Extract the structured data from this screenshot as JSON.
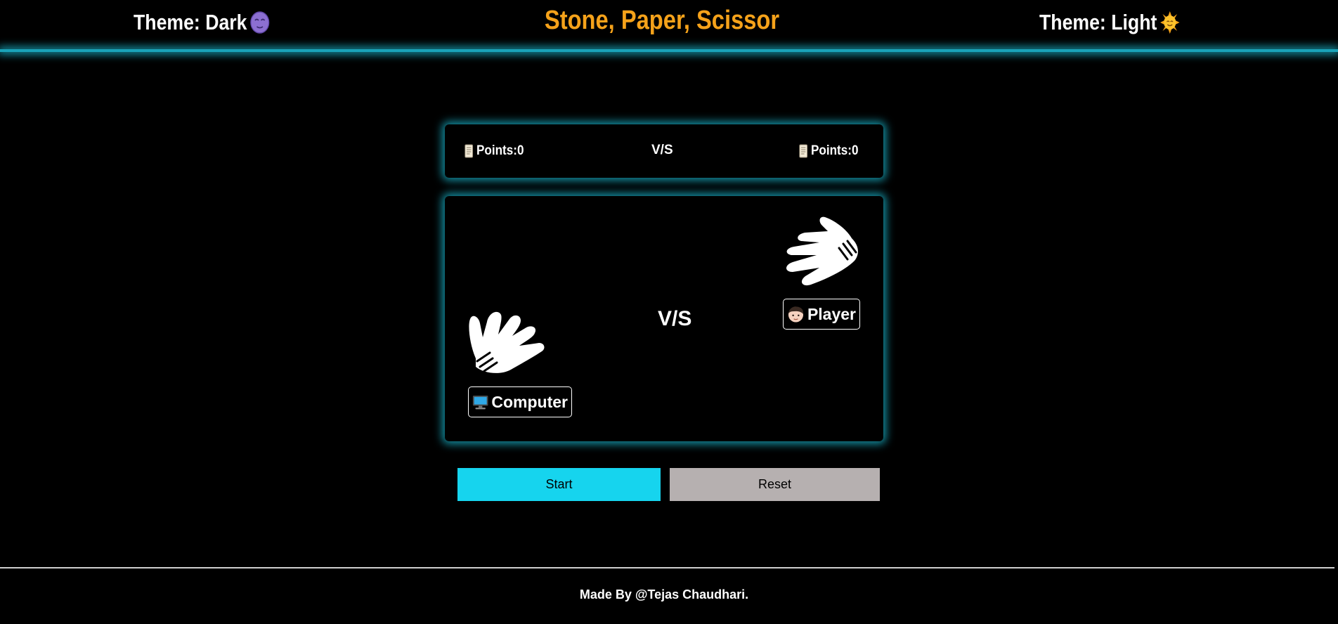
{
  "header": {
    "theme_dark_label": "Theme: Dark",
    "theme_light_label": "Theme: Light",
    "title": "Stone, Paper, Scissor"
  },
  "scoreboard": {
    "left_points_label": "Points:0",
    "vs_label": "V/S",
    "right_points_label": "Points:0"
  },
  "arena": {
    "vs_label": "V/S",
    "computer_label": "Computer",
    "player_label": "Player",
    "computer_hand_icon": "paper-hand-icon",
    "player_hand_icon": "paper-hand-icon"
  },
  "controls": {
    "start_label": "Start",
    "reset_label": "Reset"
  },
  "footer": {
    "credit": "Made By @Tejas Chaudhari."
  },
  "colors": {
    "background": "#000000",
    "accent_glow": "#1bbed6",
    "title": "#f5a21a",
    "start_button": "#16d4ee",
    "reset_button": "#b6b0b0"
  }
}
